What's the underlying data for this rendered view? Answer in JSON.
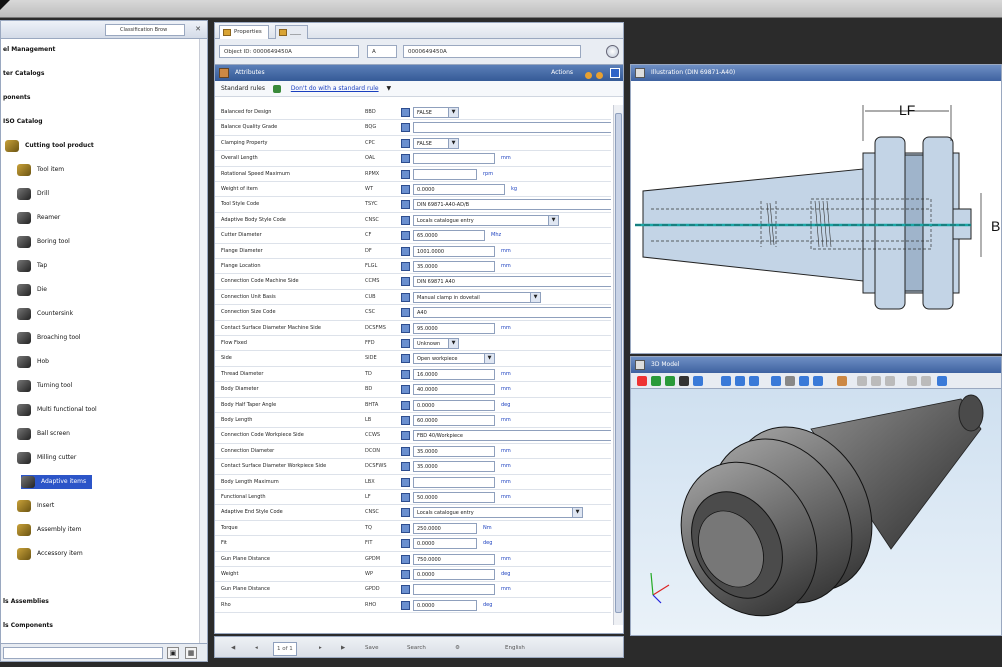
{
  "left_panel": {
    "tab_label": "Classification Brow",
    "tree": [
      {
        "label": "el Management",
        "bold": true,
        "icon": "none"
      },
      {
        "label": "ter Catalogs",
        "bold": true,
        "icon": "none"
      },
      {
        "label": "ponents",
        "bold": true,
        "icon": "none"
      },
      {
        "label": "ISO Catalog",
        "bold": true,
        "icon": "none"
      },
      {
        "label": "Cutting tool product",
        "bold": true,
        "icon": "gold"
      },
      {
        "label": "Tool item",
        "bold": false,
        "icon": "gold"
      },
      {
        "label": "Drill",
        "bold": false,
        "icon": "dark"
      },
      {
        "label": "Reamer",
        "bold": false,
        "icon": "dark"
      },
      {
        "label": "Boring tool",
        "bold": false,
        "icon": "dark"
      },
      {
        "label": "Tap",
        "bold": false,
        "icon": "dark"
      },
      {
        "label": "Die",
        "bold": false,
        "icon": "dark"
      },
      {
        "label": "Countersink",
        "bold": false,
        "icon": "dark"
      },
      {
        "label": "Broaching tool",
        "bold": false,
        "icon": "dark"
      },
      {
        "label": "Hob",
        "bold": false,
        "icon": "dark"
      },
      {
        "label": "Turning tool",
        "bold": false,
        "icon": "dark"
      },
      {
        "label": "Multi functional tool",
        "bold": false,
        "icon": "dark"
      },
      {
        "label": "Ball screen",
        "bold": false,
        "icon": "dark"
      },
      {
        "label": "Milling cutter",
        "bold": false,
        "icon": "dark"
      },
      {
        "label": "Adaptive items",
        "bold": false,
        "icon": "dark",
        "selected": true
      },
      {
        "label": "Insert",
        "bold": false,
        "icon": "gold"
      },
      {
        "label": "Assembly item",
        "bold": false,
        "icon": "gold"
      },
      {
        "label": "Accessory item",
        "bold": false,
        "icon": "gold"
      },
      {
        "label": "",
        "bold": false,
        "icon": "none"
      },
      {
        "label": "ls Assemblies",
        "bold": true,
        "icon": "none"
      },
      {
        "label": "ls Components",
        "bold": true,
        "icon": "none"
      }
    ]
  },
  "center": {
    "tabs": [
      {
        "label": "Properties",
        "active": true
      },
      {
        "label": "____",
        "active": false
      }
    ],
    "id_row": {
      "label_value": "Object ID: 0000649450A",
      "field2": "A",
      "field3": "0000649450A"
    },
    "props_header": "Attributes",
    "props_actions": "Actions",
    "standard_label": "Standard rules",
    "standard_link": "Don't do with a standard rule",
    "rows": [
      {
        "name": "Balanced for Design",
        "code": "BBD",
        "value": "FALSE",
        "kind": "dropdown",
        "width": 46,
        "unit": ""
      },
      {
        "name": "Balance Quality Grade",
        "code": "BQG",
        "value": "",
        "kind": "text",
        "width": 206,
        "unit": ""
      },
      {
        "name": "Clamping Property",
        "code": "CPC",
        "value": "FALSE",
        "kind": "dropdown",
        "width": 46,
        "unit": ""
      },
      {
        "name": "Overall Length",
        "code": "OAL",
        "value": "",
        "kind": "text",
        "width": 82,
        "unit": "mm"
      },
      {
        "name": "Rotational Speed Maximum",
        "code": "RPMX",
        "value": "",
        "kind": "text",
        "width": 64,
        "unit": "rpm"
      },
      {
        "name": "Weight of item",
        "code": "WT",
        "value": "0.0000",
        "kind": "text",
        "width": 92,
        "unit": "kg"
      },
      {
        "name": "Tool Style Code",
        "code": "TSYC",
        "value": "DIN 69871-A40-AD/B",
        "kind": "text",
        "width": 206,
        "unit": ""
      },
      {
        "name": "Adaptive Body Style Code",
        "code": "CNSC",
        "value": "Locals catalogue entry",
        "kind": "dropdown",
        "width": 146,
        "unit": ""
      },
      {
        "name": "Cutter Diameter",
        "code": "CF",
        "value": "65.0000",
        "kind": "text",
        "width": 72,
        "unit": "Mhz"
      },
      {
        "name": "Flange Diameter",
        "code": "DF",
        "value": "1001.0000",
        "kind": "text",
        "width": 82,
        "unit": "mm"
      },
      {
        "name": "Flange Location",
        "code": "FLGL",
        "value": "35.0000",
        "kind": "text",
        "width": 82,
        "unit": "mm"
      },
      {
        "name": "Connection Code Machine Side",
        "code": "CCMS",
        "value": "DIN 69871 A40",
        "kind": "text",
        "width": 206,
        "unit": ""
      },
      {
        "name": "Connection Unit Basis",
        "code": "CUB",
        "value": "Manual clamp in dovetail",
        "kind": "dropdown",
        "width": 128,
        "unit": ""
      },
      {
        "name": "Connection Size Code",
        "code": "CSC",
        "value": "A40",
        "kind": "text",
        "width": 206,
        "unit": ""
      },
      {
        "name": "Contact Surface Diameter Machine Side",
        "code": "DCSFMS",
        "value": "95.0000",
        "kind": "text",
        "width": 82,
        "unit": "mm"
      },
      {
        "name": "Flow Fixed",
        "code": "FFD",
        "value": "Unknown",
        "kind": "dropdown",
        "width": 46,
        "unit": ""
      },
      {
        "name": "Side",
        "code": "SIDE",
        "value": "Open workpiece",
        "kind": "dropdown",
        "width": 82,
        "unit": ""
      },
      {
        "name": "Thread Diameter",
        "code": "TD",
        "value": "16.0000",
        "kind": "text",
        "width": 82,
        "unit": "mm"
      },
      {
        "name": "Body Diameter",
        "code": "BD",
        "value": "40.0000",
        "kind": "text",
        "width": 82,
        "unit": "mm"
      },
      {
        "name": "Body Half Taper Angle",
        "code": "BHTA",
        "value": "0.0000",
        "kind": "text",
        "width": 82,
        "unit": "deg"
      },
      {
        "name": "Body Length",
        "code": "LB",
        "value": "60.0000",
        "kind": "text",
        "width": 82,
        "unit": "mm"
      },
      {
        "name": "Connection Code Workpiece Side",
        "code": "CCWS",
        "value": "FBD 40/Workpiece",
        "kind": "text",
        "width": 206,
        "unit": ""
      },
      {
        "name": "Connection Diameter",
        "code": "DCON",
        "value": "35.0000",
        "kind": "text",
        "width": 82,
        "unit": "mm"
      },
      {
        "name": "Contact Surface Diameter Workpiece Side",
        "code": "DCSFWS",
        "value": "35.0000",
        "kind": "text",
        "width": 82,
        "unit": "mm"
      },
      {
        "name": "Body Length Maximum",
        "code": "LBX",
        "value": "",
        "kind": "text",
        "width": 82,
        "unit": "mm"
      },
      {
        "name": "Functional Length",
        "code": "LF",
        "value": "50.0000",
        "kind": "text",
        "width": 82,
        "unit": "mm"
      },
      {
        "name": "Adaptive End Style Code",
        "code": "CNSC",
        "value": "Locals catalogue entry",
        "kind": "dropdown",
        "width": 170,
        "unit": ""
      },
      {
        "name": "Torque",
        "code": "TQ",
        "value": "250.0000",
        "kind": "text",
        "width": 64,
        "unit": "Nm"
      },
      {
        "name": "Fit",
        "code": "FIT",
        "value": "0.0000",
        "kind": "text",
        "width": 64,
        "unit": "deg"
      },
      {
        "name": "Gun Plane Distance",
        "code": "GPDM",
        "value": "750.0000",
        "kind": "text",
        "width": 82,
        "unit": "mm"
      },
      {
        "name": "Weight",
        "code": "WP",
        "value": "0.0000",
        "kind": "text",
        "width": 82,
        "unit": "deg"
      },
      {
        "name": "Gun Plane Distance",
        "code": "GPDD",
        "value": "",
        "kind": "text",
        "width": 82,
        "unit": "mm"
      },
      {
        "name": "Rho",
        "code": "RHO",
        "value": "0.0000",
        "kind": "text",
        "width": 64,
        "unit": "deg"
      }
    ],
    "bottom_bar": {
      "page": "1 of 1",
      "save": "Save",
      "search": "Search",
      "english": "English"
    }
  },
  "drawing": {
    "header": "Illustration (DIN 69871-A40)",
    "dim_top": "LF",
    "dim_right": "B"
  },
  "view3d": {
    "header": "3D Model"
  }
}
